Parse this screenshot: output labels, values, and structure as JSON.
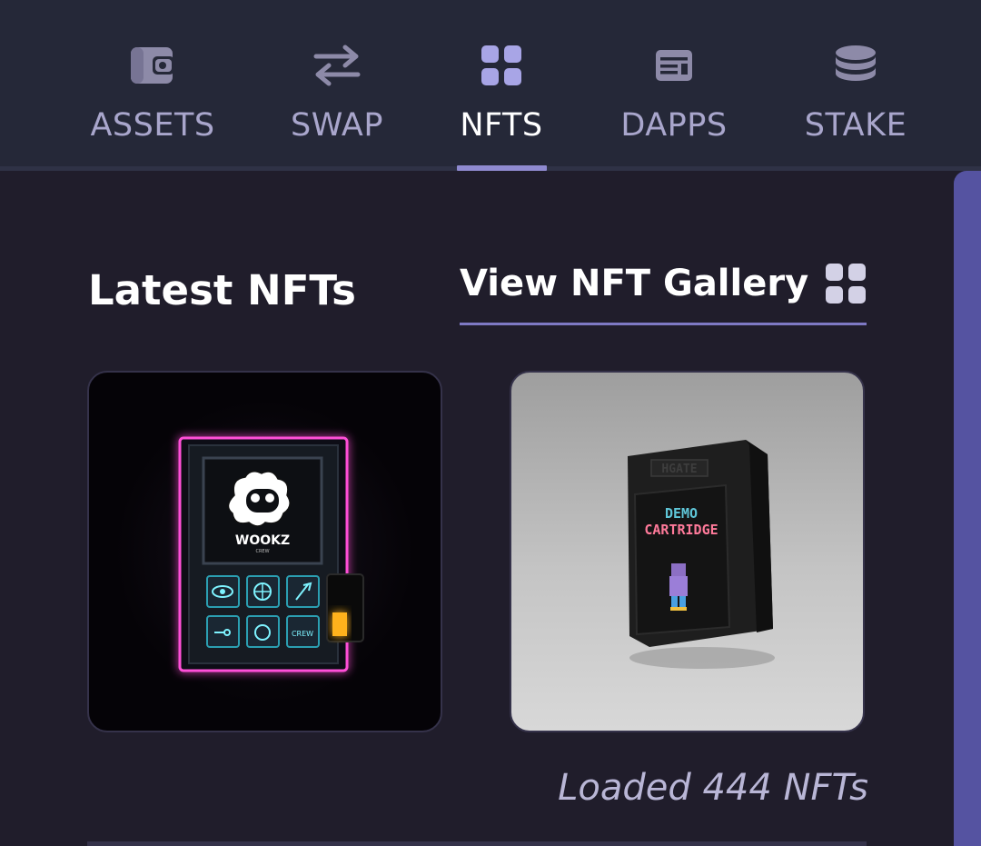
{
  "nav": {
    "tabs": [
      {
        "label": "ASSETS",
        "icon": "wallet-icon"
      },
      {
        "label": "SWAP",
        "icon": "swap-arrows-icon"
      },
      {
        "label": "NFTS",
        "icon": "grid-icon"
      },
      {
        "label": "DAPPS",
        "icon": "dapps-icon"
      },
      {
        "label": "STAKE",
        "icon": "coin-stack-icon"
      }
    ],
    "active_tab": "NFTS"
  },
  "section": {
    "title": "Latest NFTs",
    "gallery_link": "View NFT Gallery",
    "gallery_icon": "grid-icon"
  },
  "nfts": [
    {
      "name": "WOOKZ",
      "subtitle": "CREW",
      "badge": "CREW"
    },
    {
      "name": "HGATE",
      "line1": "DEMO",
      "line2": "CARTRIDGE"
    }
  ],
  "status": "Loaded 444 NFTs",
  "colors": {
    "background": "#201d2b",
    "nav_background": "#252838",
    "accent": "#8f8ad0",
    "tab_inactive": "#a9a6cc",
    "scrollbar": "#5553a1"
  }
}
